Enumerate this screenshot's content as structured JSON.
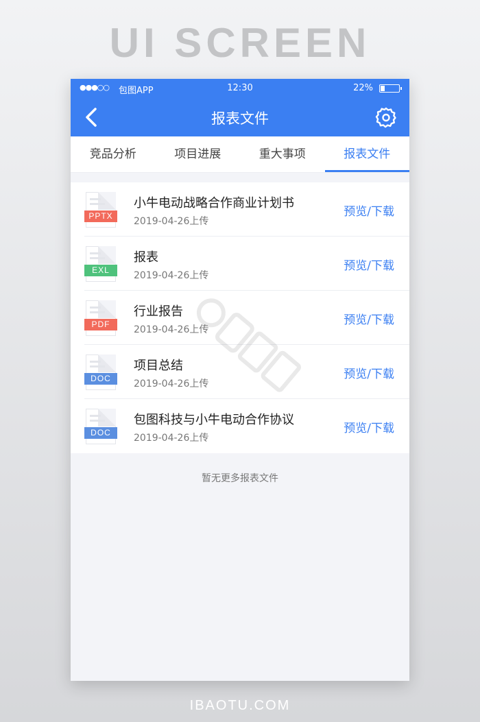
{
  "page_heading": "UI SCREEN",
  "footer_site": "IBAOTU.COM",
  "status_bar": {
    "signal": "●●●○○",
    "carrier": "包图APP",
    "time": "12:30",
    "battery": "22%"
  },
  "nav": {
    "title": "报表文件",
    "back_icon": "chevron-left-icon",
    "settings_icon": "gear-icon"
  },
  "tabs": [
    {
      "label": "竞品分析",
      "active": false
    },
    {
      "label": "项目进展",
      "active": false
    },
    {
      "label": "重大事项",
      "active": false
    },
    {
      "label": "报表文件",
      "active": true
    }
  ],
  "files": [
    {
      "name": "小牛电动战略合作商业计划书",
      "date": "2019-04-26上传",
      "type": "PPTX",
      "color": "#f26a5b",
      "action": "预览/下载"
    },
    {
      "name": "报表",
      "date": "2019-04-26上传",
      "type": "EXL",
      "color": "#4fc27c",
      "action": "预览/下载"
    },
    {
      "name": "行业报告",
      "date": "2019-04-26上传",
      "type": "PDF",
      "color": "#f26a5b",
      "action": "预览/下载"
    },
    {
      "name": "项目总结",
      "date": "2019-04-26上传",
      "type": "DOC",
      "color": "#5b8fe0",
      "action": "预览/下载"
    },
    {
      "name": "包图科技与小牛电动合作协议",
      "date": "2019-04-26上传",
      "type": "DOC",
      "color": "#5b8fe0",
      "action": "预览/下载"
    }
  ],
  "empty_note": "暂无更多报表文件",
  "colors": {
    "accent": "#3b7ff2",
    "background": "#f3f4f8"
  }
}
